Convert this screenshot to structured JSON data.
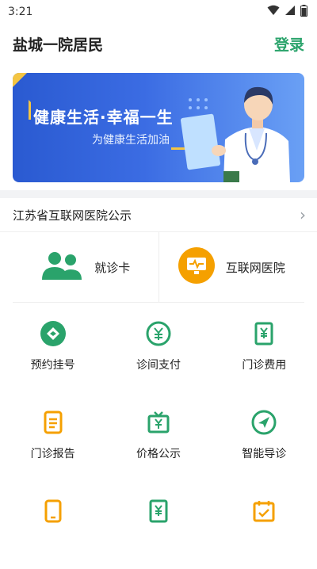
{
  "status_bar": {
    "time": "3:21"
  },
  "header": {
    "title": "盐城一院居民",
    "login_label": "登录"
  },
  "banner": {
    "title": "健康生活·幸福一生",
    "subtitle": "为健康生活加油"
  },
  "notice": {
    "text": "江苏省互联网医院公示",
    "arrow": "›"
  },
  "cards": [
    {
      "label": "就诊卡",
      "icon": "group-icon"
    },
    {
      "label": "互联网医院",
      "icon": "monitor-icon"
    }
  ],
  "grid": [
    {
      "label": "预约挂号",
      "icon": "appointment-icon"
    },
    {
      "label": "诊间支付",
      "icon": "yuan-payment-icon"
    },
    {
      "label": "门诊费用",
      "icon": "receipt-icon"
    },
    {
      "label": "门诊报告",
      "icon": "report-icon"
    },
    {
      "label": "价格公示",
      "icon": "price-tv-icon"
    },
    {
      "label": "智能导诊",
      "icon": "navigation-icon"
    },
    {
      "label": "",
      "icon": "tablet-icon"
    },
    {
      "label": "",
      "icon": "bill-icon"
    },
    {
      "label": "",
      "icon": "calendar-icon"
    }
  ],
  "colors": {
    "brand_green": "#2aa36b",
    "accent_orange": "#f5a000",
    "banner_blue": "#2a5ad1"
  }
}
